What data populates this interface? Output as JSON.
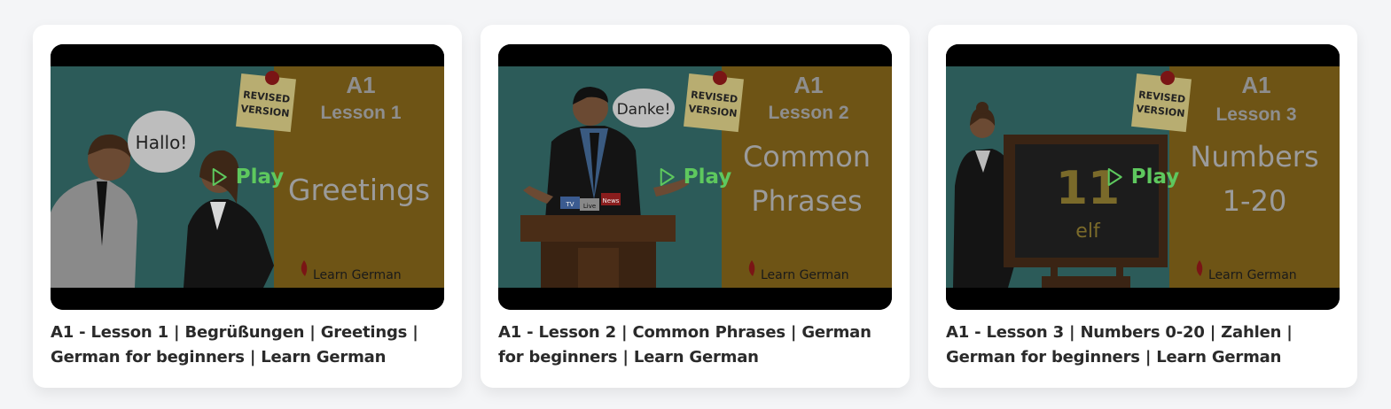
{
  "videos": [
    {
      "title": "A1 - Lesson 1 | Begrüßungen | Greetings | German for beginners | Learn German",
      "thumb": {
        "badge_line1": "REVISED",
        "badge_line2": "VERSION",
        "level": "A1",
        "lesson": "Lesson 1",
        "topic_line1": "Greetings",
        "topic_line2": "",
        "speech": "Hallo!",
        "brand": "Learn German"
      },
      "play_label": "Play"
    },
    {
      "title": "A1 - Lesson 2 | Common Phrases | German for beginners | Learn German",
      "thumb": {
        "badge_line1": "REVISED",
        "badge_line2": "VERSION",
        "level": "A1",
        "lesson": "Lesson 2",
        "topic_line1": "Common",
        "topic_line2": "Phrases",
        "speech": "Danke!",
        "mic_labels": [
          "TV",
          "Live",
          "News"
        ],
        "brand": "Learn German"
      },
      "play_label": "Play"
    },
    {
      "title": "A1 - Lesson 3 | Numbers 0-20 | Zahlen | German for beginners | Learn German",
      "thumb": {
        "badge_line1": "REVISED",
        "badge_line2": "VERSION",
        "level": "A1",
        "lesson": "Lesson 3",
        "topic_line1": "Numbers",
        "topic_line2": "1-20",
        "board_number": "11",
        "board_word": "elf",
        "brand": "Learn German"
      },
      "play_label": "Play"
    }
  ],
  "colors": {
    "teal": "#2c5b59",
    "mustard": "#6e5415",
    "play_green": "#5ec85e"
  }
}
